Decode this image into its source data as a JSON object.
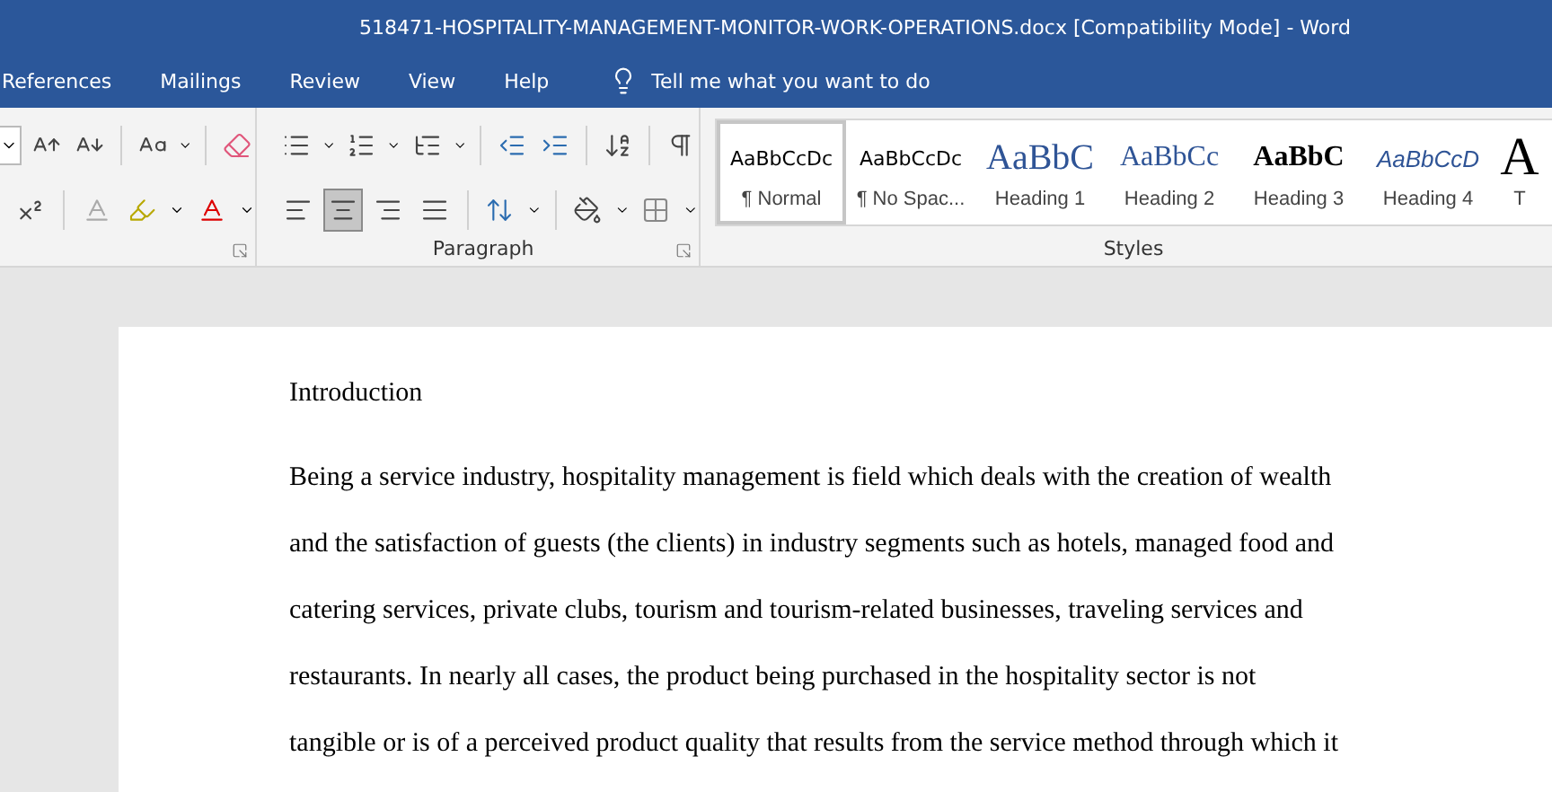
{
  "window": {
    "title": "518471-HOSPITALITY-MANAGEMENT-MONITOR-WORK-OPERATIONS.docx [Compatibility Mode]  -  Word"
  },
  "ribbon_tabs": [
    {
      "label": "References"
    },
    {
      "label": "Mailings"
    },
    {
      "label": "Review"
    },
    {
      "label": "View"
    },
    {
      "label": "Help"
    }
  ],
  "tell_me": {
    "placeholder": "Tell me what you want to do"
  },
  "paragraph_group": {
    "label": "Paragraph",
    "alignment": [
      {
        "kind": "left",
        "selected": false
      },
      {
        "kind": "center",
        "selected": true
      },
      {
        "kind": "right",
        "selected": false
      },
      {
        "kind": "justify",
        "selected": false
      }
    ]
  },
  "styles_group": {
    "label": "Styles",
    "items": [
      {
        "kind": "normal",
        "preview": "AaBbCcDc",
        "name": "¶ Normal",
        "selected": true
      },
      {
        "kind": "normal",
        "preview": "AaBbCcDc",
        "name": "¶ No Spac...",
        "selected": false
      },
      {
        "kind": "heading1",
        "preview": "AaBbC",
        "name": "Heading 1",
        "selected": false
      },
      {
        "kind": "heading2",
        "preview": "AaBbCc",
        "name": "Heading 2",
        "selected": false
      },
      {
        "kind": "heading3",
        "preview": "AaBbC",
        "name": "Heading 3",
        "selected": false
      },
      {
        "kind": "heading4",
        "preview": "AaBbCcD",
        "name": "Heading 4",
        "selected": false
      },
      {
        "kind": "title",
        "preview": "A",
        "name": "T",
        "selected": false
      }
    ]
  },
  "document": {
    "heading": "Introduction",
    "lines": [
      "Being a service industry, hospitality management is field which deals with the creation of wealth",
      "and the satisfaction of guests (the clients) in industry segments such as hotels, managed food and",
      "catering services, private clubs, tourism and tourism-related businesses, traveling services and",
      "restaurants. In nearly all cases, the product being purchased in the hospitality sector is not",
      "tangible or is of a perceived product quality that results from the service method through which it"
    ]
  }
}
